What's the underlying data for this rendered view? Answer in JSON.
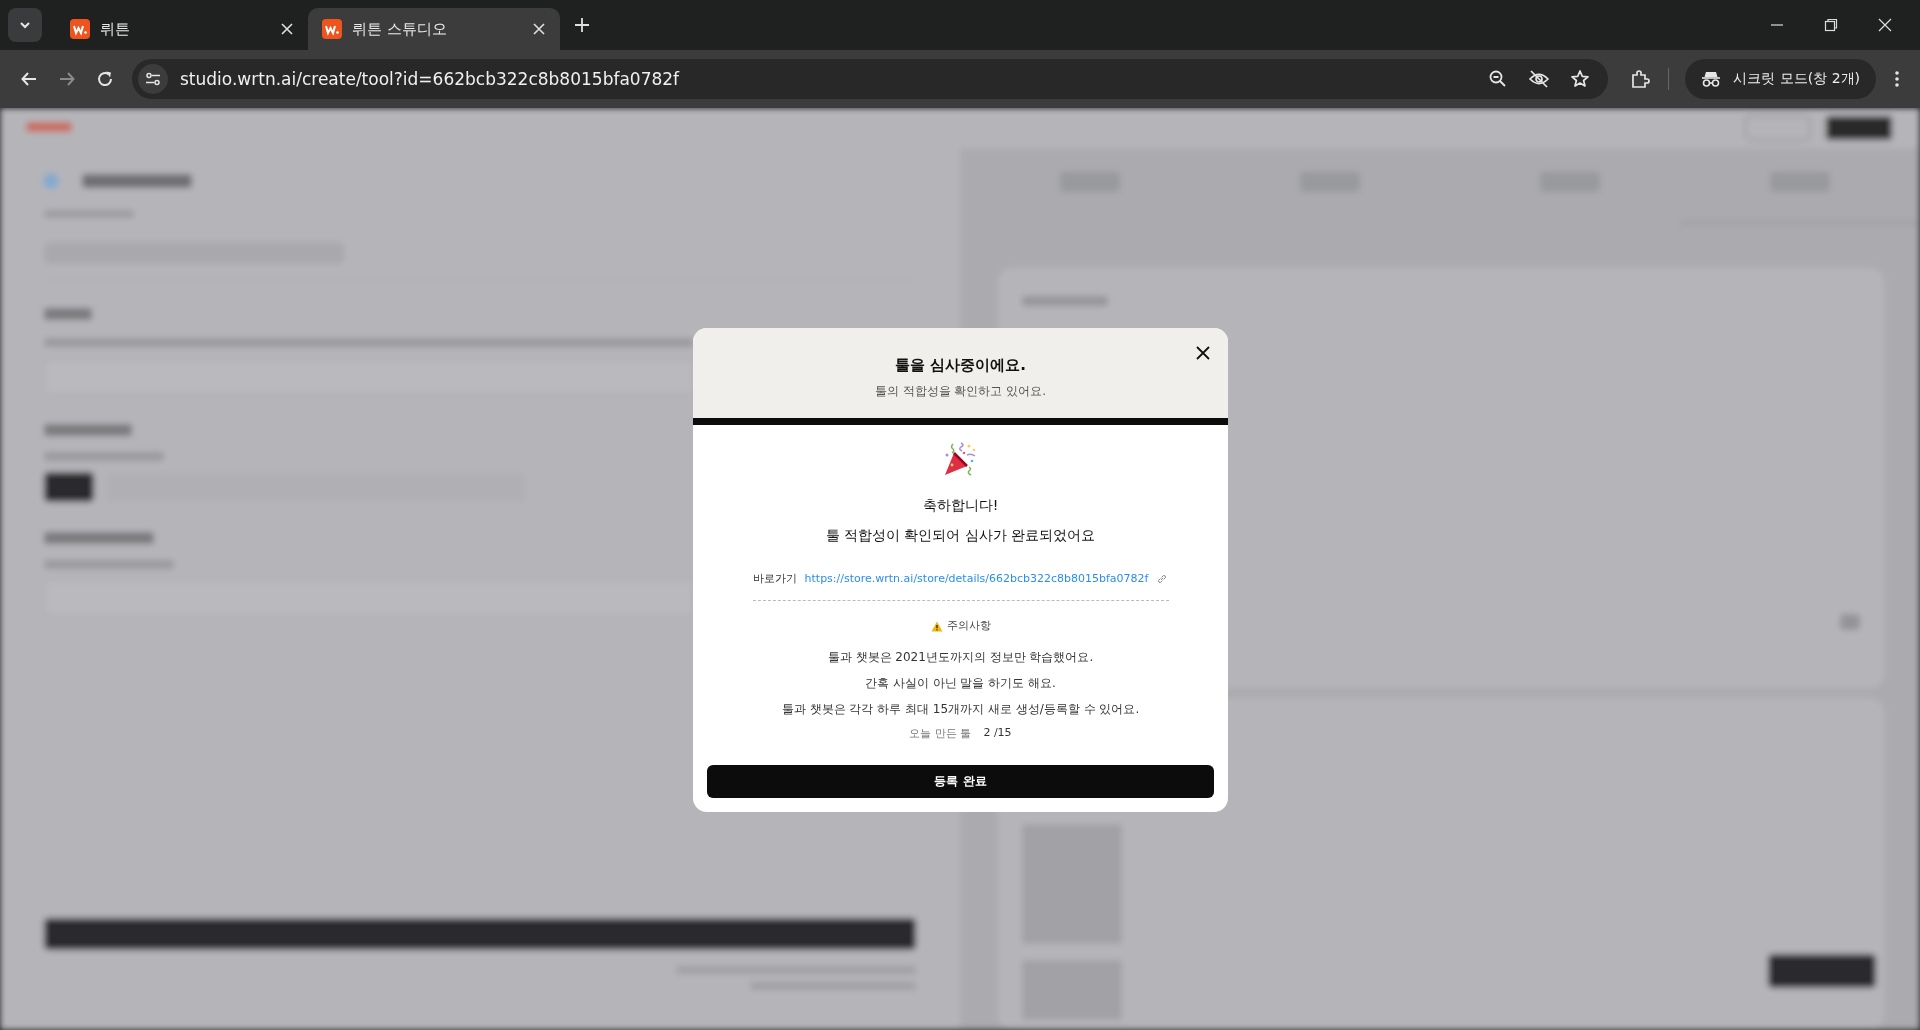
{
  "browser": {
    "tabs": [
      {
        "title": "뤼튼",
        "selected": false
      },
      {
        "title": "뤼튼 스튜디오",
        "selected": true
      }
    ],
    "url": "studio.wrtn.ai/create/tool?id=662bcb322c8b8015bfa0782f",
    "profile": "시크릿 모드(창 2개)"
  },
  "modal": {
    "title": "툴을 심사중이에요.",
    "subtitle": "툴의 적합성을 확인하고 있어요.",
    "heading": "축하합니다!",
    "message": "툴 적합성이 확인되어 심사가 완료되었어요",
    "link_label": "바로가기",
    "link": "https://store.wrtn.ai/store/details/662bcb322c8b8015bfa0782f",
    "notice_title": "주의사항",
    "notice_lines": [
      "툴과 챗봇은 2021년도까지의 정보만 학습했어요.",
      "간혹 사실이 아닌 말을 하기도 해요.",
      "툴과 챗봇은 각각 하루 최대 15개까지 새로 생성/등록할 수 있어요."
    ],
    "count_label": "오늘 만든 툴",
    "count": "2 /15",
    "button": "등록 완료"
  }
}
